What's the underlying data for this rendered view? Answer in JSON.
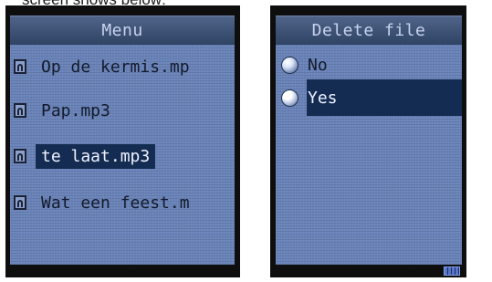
{
  "caption": "screen shows below:",
  "left_screen": {
    "title": "Menu",
    "items": [
      {
        "label": "Op de kermis.mp",
        "icon": "music-file-icon",
        "selected": false
      },
      {
        "label": "Pap.mp3",
        "icon": "music-file-icon",
        "selected": false
      },
      {
        "label": "te laat.mp3",
        "icon": "music-file-icon",
        "selected": true
      },
      {
        "label": "Wat een feest.m",
        "icon": "music-file-icon",
        "selected": false
      }
    ]
  },
  "right_screen": {
    "title": "Delete file",
    "options": [
      {
        "label": "No",
        "icon": "radio-icon",
        "selected": false
      },
      {
        "label": "Yes",
        "icon": "radio-icon",
        "selected": true
      }
    ],
    "status_icon": "battery-icon"
  },
  "colors": {
    "screen_background": "#6a84ba",
    "titlebar": "#3e5277",
    "selection": "#142c52",
    "selected_text": "#eef2ff"
  }
}
